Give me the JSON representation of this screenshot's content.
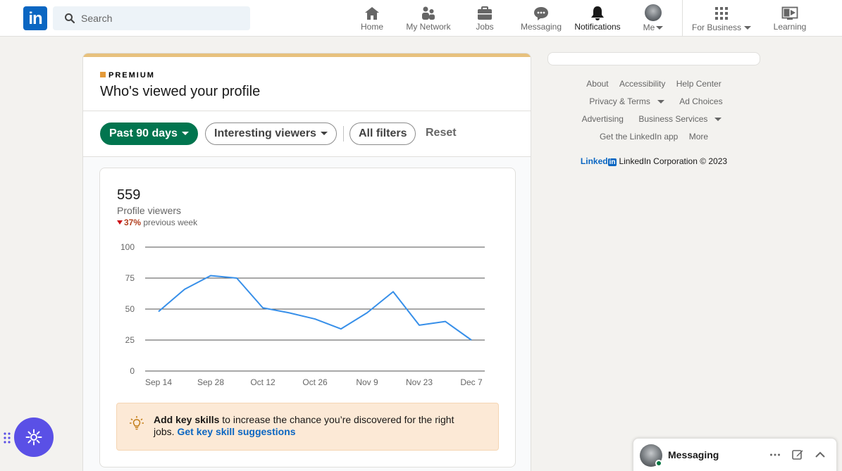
{
  "nav": {
    "logo_text": "in",
    "search_placeholder": "Search",
    "items": [
      {
        "label": "Home",
        "icon": "home-icon"
      },
      {
        "label": "My Network",
        "icon": "network-icon"
      },
      {
        "label": "Jobs",
        "icon": "briefcase-icon"
      },
      {
        "label": "Messaging",
        "icon": "messaging-icon"
      },
      {
        "label": "Notifications",
        "icon": "bell-icon"
      },
      {
        "label": "Me",
        "icon": "avatar"
      },
      {
        "label": "For Business",
        "icon": "grid-icon"
      },
      {
        "label": "Learning",
        "icon": "learning-icon"
      }
    ]
  },
  "card": {
    "premium_label": "PREMIUM",
    "title": "Who's viewed your profile",
    "filters": {
      "range": "Past 90 days",
      "viewers": "Interesting viewers",
      "all": "All filters",
      "reset": "Reset"
    },
    "stats": {
      "count": "559",
      "label": "Profile viewers",
      "change": "37%",
      "change_suffix": "previous week"
    },
    "tip": {
      "bold": "Add key skills",
      "text": " to increase the chance you’re discovered for the right jobs. ",
      "link": "Get key skill suggestions"
    }
  },
  "chart_data": {
    "type": "line",
    "x": [
      "Sep 14",
      "Sep 21",
      "Sep 28",
      "Oct 5",
      "Oct 12",
      "Oct 19",
      "Oct 26",
      "Nov 2",
      "Nov 9",
      "Nov 16",
      "Nov 23",
      "Nov 30",
      "Dec 7"
    ],
    "xtick_labels": [
      "Sep 14",
      "Sep 28",
      "Oct 12",
      "Oct 26",
      "Nov 9",
      "Nov 23",
      "Dec 7"
    ],
    "values": [
      48,
      66,
      77,
      75,
      51,
      47,
      42,
      34,
      47,
      64,
      37,
      40,
      25
    ],
    "yticks": [
      0,
      25,
      50,
      75,
      100
    ],
    "ylim": [
      0,
      100
    ],
    "grid": true,
    "color": "#378fe9"
  },
  "rail": {
    "links": [
      [
        "About",
        "Accessibility",
        "Help Center"
      ],
      [
        "Privacy & Terms",
        "Ad Choices"
      ],
      [
        "Advertising",
        "Business Services"
      ],
      [
        "Get the LinkedIn app",
        "More"
      ]
    ],
    "brand": "Linked",
    "brand_box": "in",
    "copyright": "LinkedIn Corporation © 2023"
  },
  "messaging": {
    "title": "Messaging"
  }
}
